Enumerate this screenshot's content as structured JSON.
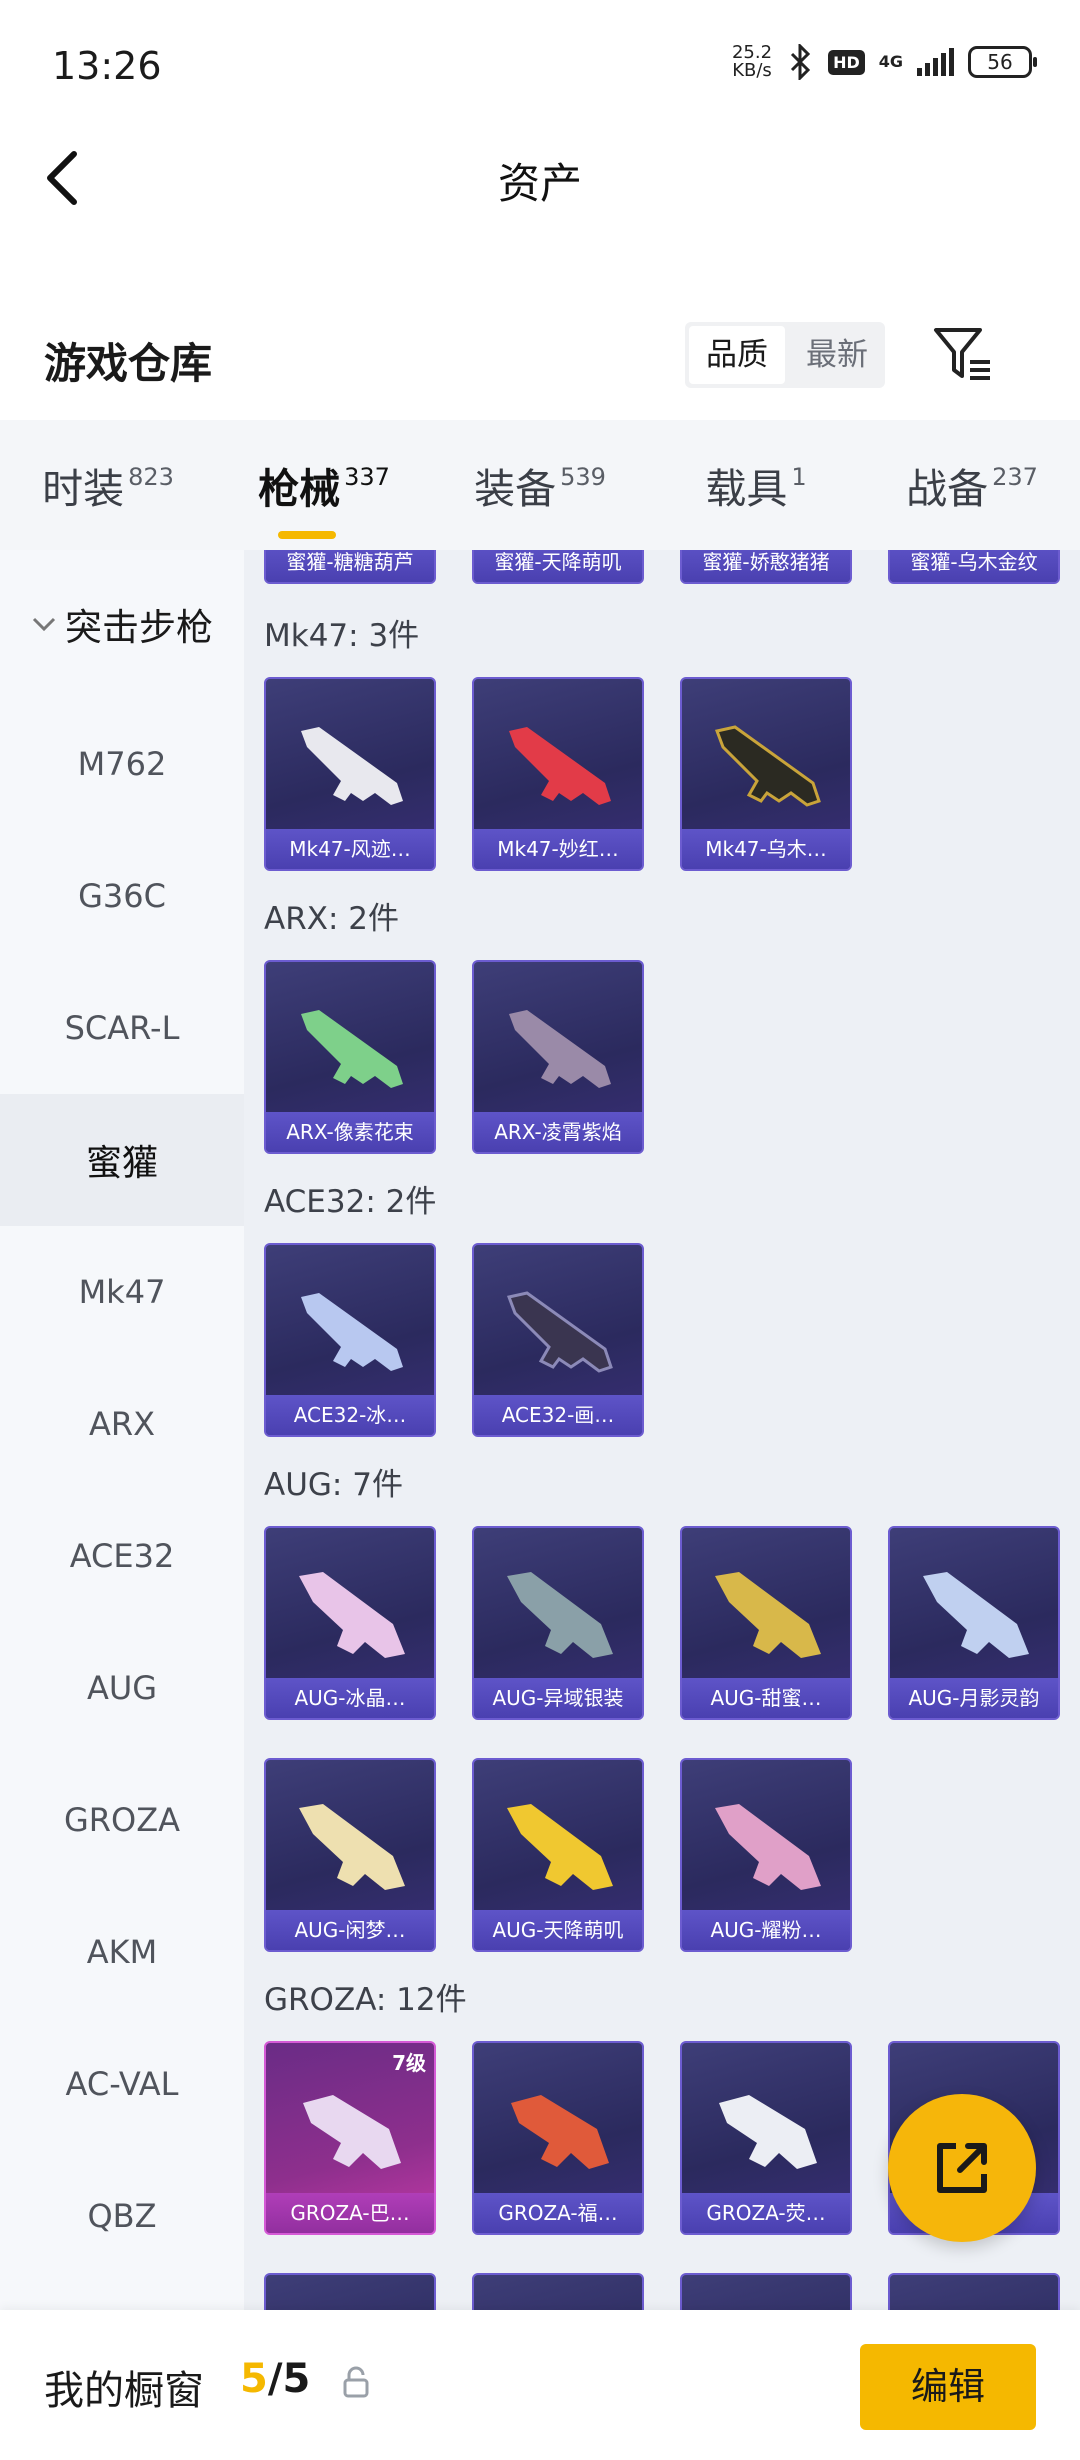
{
  "status": {
    "time": "13:26",
    "speed_value": "25.2",
    "speed_unit": "KB/s",
    "hd": "HD",
    "network": "4G",
    "battery": "56"
  },
  "nav": {
    "title": "资产"
  },
  "section": {
    "title": "游戏仓库",
    "sort_options": [
      "品质",
      "最新"
    ],
    "sort_active": "品质"
  },
  "tabs": [
    {
      "label": "时装",
      "count": "823"
    },
    {
      "label": "枪械",
      "count": "337",
      "active": true
    },
    {
      "label": "装备",
      "count": "539"
    },
    {
      "label": "载具",
      "count": "1"
    },
    {
      "label": "战备",
      "count": "237"
    }
  ],
  "sidebar": {
    "group": "突击步枪",
    "items": [
      "M762",
      "G36C",
      "SCAR-L",
      "蜜獾",
      "Mk47",
      "ARX",
      "ACE32",
      "AUG",
      "GROZA",
      "AKM",
      "AC-VAL",
      "QBZ"
    ],
    "active": "蜜獾"
  },
  "groups": [
    {
      "label": "",
      "items": [
        "蜜獾-糖糖葫芦",
        "蜜獾-天降萌叽",
        "蜜獾-娇憨猪猪",
        "蜜獾-乌木金纹"
      ]
    },
    {
      "label": "Mk47: 3件",
      "items": [
        "Mk47-风迹…",
        "Mk47-妙红…",
        "Mk47-乌木…"
      ]
    },
    {
      "label": "ARX: 2件",
      "items": [
        "ARX-像素花束",
        "ARX-凌霄紫焰"
      ]
    },
    {
      "label": "ACE32: 2件",
      "items": [
        "ACE32-冰…",
        "ACE32-画…"
      ]
    },
    {
      "label": "AUG: 7件",
      "items": [
        "AUG-冰晶…",
        "AUG-异域银装",
        "AUG-甜蜜…",
        "AUG-月影灵韵",
        "AUG-闲梦…",
        "AUG-天降萌叽",
        "AUG-耀粉…"
      ]
    },
    {
      "label": "GROZA: 12件",
      "items": [
        "GROZA-巴…",
        "GROZA-福…",
        "GROZA-荧…",
        ""
      ]
    }
  ],
  "groza_grade": "7级",
  "bottom": {
    "shelf_label": "我的橱窗",
    "shelf_used": "5",
    "shelf_sep": "/",
    "shelf_total": "5",
    "edit": "编辑"
  },
  "colors": {
    "accent": "#f5b800",
    "card_bg": "#2e2d62",
    "card_label": "#5548c0",
    "legendary": "#b03eb8"
  }
}
